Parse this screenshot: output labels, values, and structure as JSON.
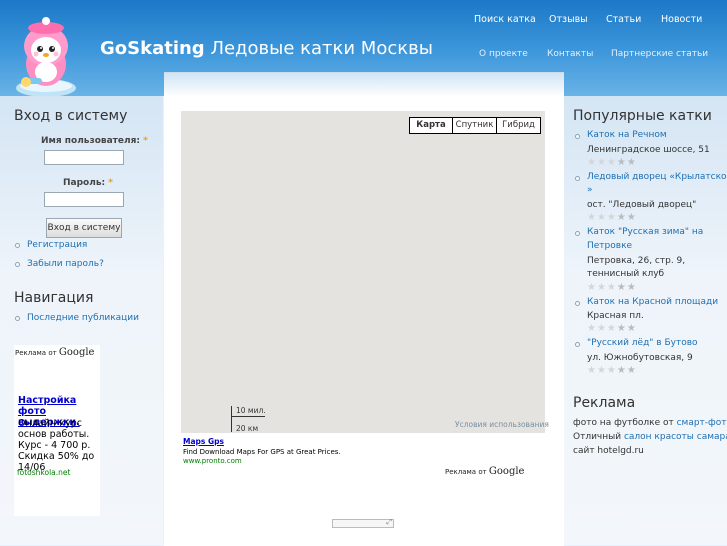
{
  "header": {
    "brand": "GoSkating",
    "tagline": "Ледовые катки Москвы",
    "top_nav": [
      "Поиск катка",
      "Отзывы",
      "Статьи",
      "Новости"
    ],
    "sub_nav": [
      "О проекте",
      "Контакты",
      "Партнерские статьи"
    ]
  },
  "login": {
    "title": "Вход в систему",
    "username_label": "Имя пользователя:",
    "password_label": "Пароль:",
    "required_mark": "*",
    "username_value": "",
    "password_value": "",
    "submit_label": "Вход в систему",
    "links": [
      "Регистрация",
      "Забыли пароль?"
    ]
  },
  "navigation": {
    "title": "Навигация",
    "items": [
      "Последние публикации"
    ]
  },
  "left_ad": {
    "ads_by": "Реклама от",
    "google": "Google",
    "title": "Настройка фото выдержки.",
    "body": [
      "Онлайн-курс",
      "основ работы.",
      "Курс - 4 700 р.",
      "Скидка 50% до",
      "14/06"
    ],
    "url": "fotoshkola.net"
  },
  "map": {
    "types": [
      "Карта",
      "Спутник",
      "Гибрид"
    ],
    "selected_type": "Карта",
    "scale_miles": "10 мил.",
    "scale_km": "20 км",
    "terms": "Условия использования"
  },
  "center_ad": {
    "title": "Maps Gps",
    "body": "Find Download Maps For GPS at Great Prices.",
    "url": "www.pronto.com",
    "ads_by": "Реклама от",
    "google": "Google"
  },
  "popular": {
    "title": "Популярные катки",
    "items": [
      {
        "name": [
          "Каток на Речном"
        ],
        "address": [
          "Ленинградское шоссе, 51"
        ],
        "rating": 0
      },
      {
        "name": [
          "Ледовый дворец «Крылатское",
          "»"
        ],
        "address": [
          "ост. \"Ледовый дворец\""
        ],
        "rating": 0
      },
      {
        "name": [
          "Каток \"Русская зима\" на",
          "Петровке"
        ],
        "address": [
          "Петровка, 26, стр. 9,",
          "теннисный клуб"
        ],
        "rating": 0
      },
      {
        "name": [
          "Каток на Красной площади"
        ],
        "address": [
          "Красная пл."
        ],
        "rating": 0
      },
      {
        "name": [
          "\"Русский лёд\" в Бутово"
        ],
        "address": [
          "ул. Южнобутовская, 9"
        ],
        "rating": 0
      }
    ]
  },
  "right_ad": {
    "title": "Реклама",
    "line1_text": "фото на футболке от ",
    "line1_link": "смарт-фото",
    "line2_text": "Отличный ",
    "line2_link": "салон красоты самара",
    "line3": "сайт hotelgd.ru"
  },
  "colors": {
    "header_top": "#1c78c7",
    "header_bottom": "#69b3e6",
    "link": "#1f6fb2",
    "map_bg": "#e5e3df"
  }
}
